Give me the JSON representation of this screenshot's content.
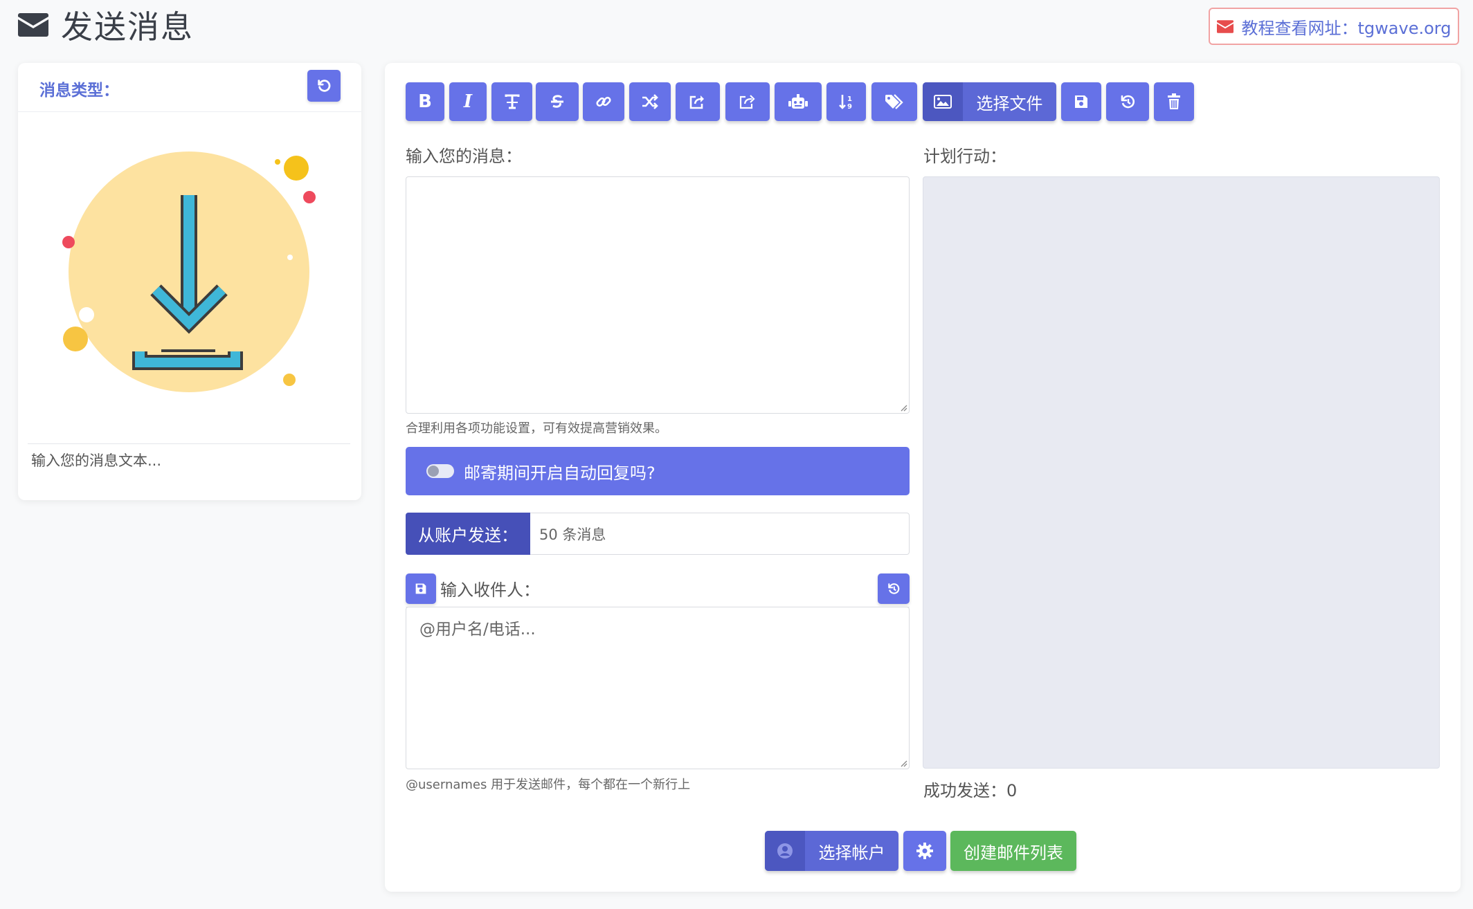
{
  "header": {
    "title": "发送消息",
    "title_icon": "envelope-icon",
    "tutorial_link": "教程查看网址：tgwave.org"
  },
  "left_panel": {
    "message_type_label": "消息类型：",
    "preview_text": "输入您的消息文本..."
  },
  "toolbar": {
    "buttons": [
      "bold-icon",
      "italic-icon",
      "text-height-icon",
      "strikethrough-icon",
      "link-icon",
      "shuffle-icon",
      "share-square-icon",
      "share-icon",
      "robot-icon",
      "sort-numeric-icon",
      "tags-icon",
      "image-icon",
      "save-icon",
      "history-icon",
      "trash-icon"
    ],
    "choose_file_label": "选择文件"
  },
  "message": {
    "label": "输入您的消息：",
    "value": "",
    "help_text": "合理利用各项功能设置，可有效提高营销效果。"
  },
  "auto_reply": {
    "label": "邮寄期间开启自动回复吗?",
    "enabled": false
  },
  "send_from": {
    "label": "从账户发送：",
    "value": "50 条消息"
  },
  "recipients": {
    "label": "输入收件人：",
    "placeholder": "@用户名/电话...",
    "help_text": "@usernames 用于发送邮件，每个都在一个新行上"
  },
  "plan": {
    "label": "计划行动：",
    "success_text": "成功发送：0"
  },
  "bottom_buttons": {
    "choose_account": "选择帐户",
    "create_list": "创建邮件列表"
  },
  "colors": {
    "primary": "#6672e8",
    "primary_dark": "#4650b8",
    "success": "#5cb85c",
    "danger": "#e74c4c"
  }
}
